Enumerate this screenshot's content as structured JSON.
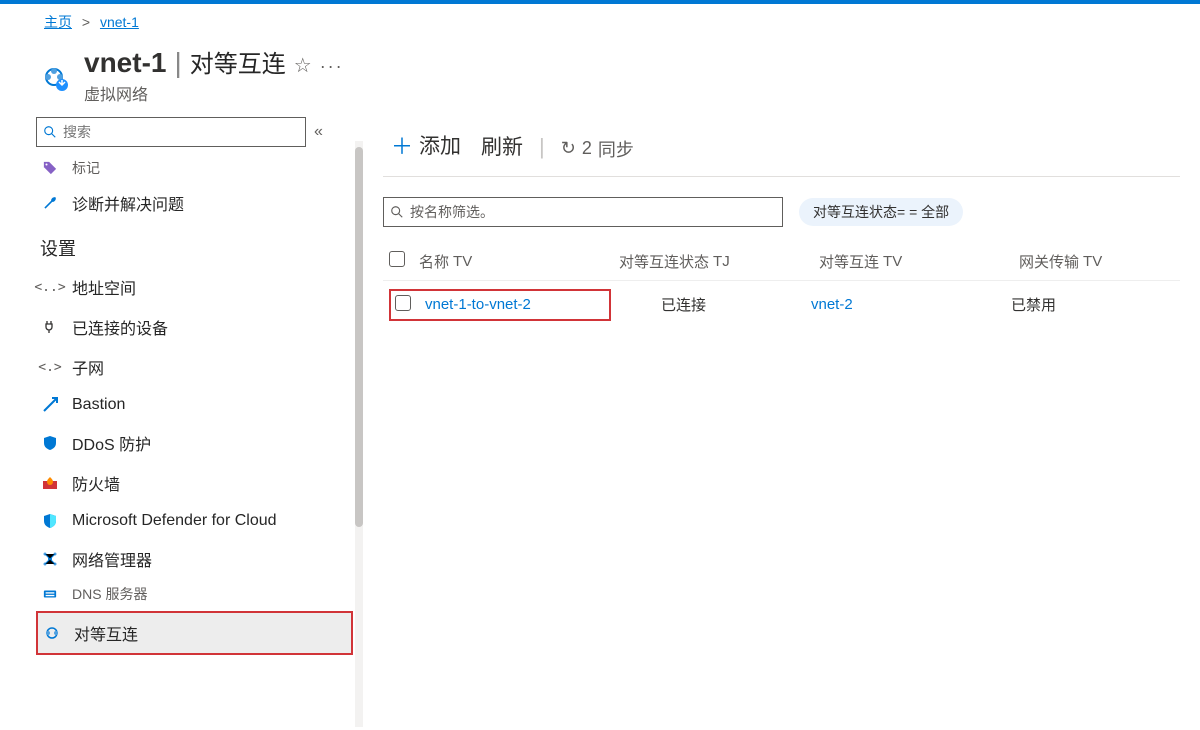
{
  "breadcrumbs": {
    "home": "主页",
    "current": "vnet-1"
  },
  "header": {
    "title": "vnet-1",
    "page": "对等互连",
    "resource_type": "虚拟网络"
  },
  "sidebar": {
    "search_placeholder": "搜索",
    "items": {
      "tags": "标记",
      "diagnose": "诊断并解决问题",
      "settings": "设置",
      "address_space": "地址空间",
      "connected_devices": "已连接的设备",
      "subnets": "子网",
      "bastion": "Bastion",
      "ddos": "DDoS 防护",
      "firewall": "防火墙",
      "defender": "Microsoft Defender for Cloud",
      "net_manager": "网络管理器",
      "dns": "DNS 服务器",
      "peerings": "对等互连"
    }
  },
  "toolbar": {
    "add": "添加",
    "refresh": "刷新",
    "sync": "同步",
    "sync_count": "2"
  },
  "filters": {
    "name_placeholder": "按名称筛选。",
    "status_pill": "对等互连状态= = 全部"
  },
  "table": {
    "headers": {
      "name": "名称",
      "status": "对等互连状态",
      "peer": "对等互连",
      "gateway": "网关传输"
    },
    "sort_icon": "T",
    "rows": [
      {
        "name": "vnet-1-to-vnet-2",
        "status": "已连接",
        "peer": "vnet-2",
        "gateway": "已禁用"
      }
    ]
  }
}
